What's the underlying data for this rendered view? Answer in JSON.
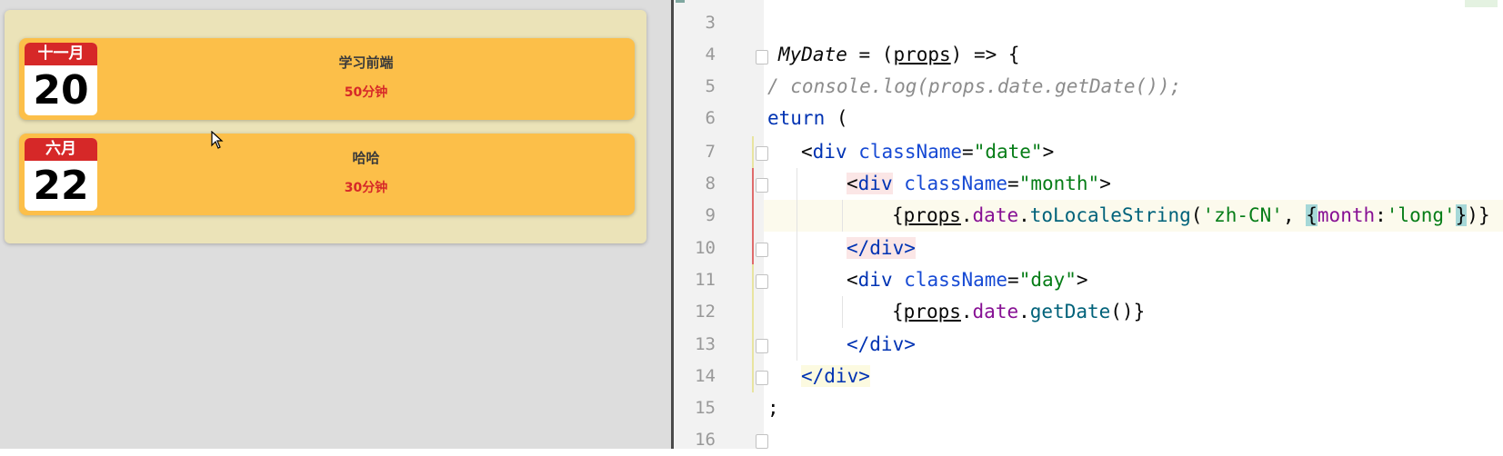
{
  "preview": {
    "items": [
      {
        "month": "十一月",
        "day": "20",
        "desc": "学习前端",
        "time": "50分钟"
      },
      {
        "month": "六月",
        "day": "22",
        "desc": "哈哈",
        "time": "30分钟"
      }
    ]
  },
  "editor": {
    "line_numbers": [
      "3",
      "4",
      "5",
      "6",
      "7",
      "8",
      "9",
      "10",
      "11",
      "12",
      "13",
      "14",
      "15",
      "16"
    ],
    "code": {
      "l4_name": "MyDate",
      "l4_eq": " = (",
      "l4_param": "props",
      "l4_arrow": ") => {",
      "l5_comment": "/ console.log(props.date.getDate());",
      "l6_kw": "eturn",
      "l6_paren": " (",
      "l7_open": "<",
      "l7_tag": "div",
      "l7_attr": "className",
      "l7_eq": "=",
      "l7_val": "\"date\"",
      "l7_close": ">",
      "l8_open": "<",
      "l8_tag": "div",
      "l8_attr": "className",
      "l8_eq": "=",
      "l8_val": "\"month\"",
      "l8_close": ">",
      "l9_lb": "{",
      "l9_props": "props",
      "l9_dot1": ".",
      "l9_date": "date",
      "l9_dot2": ".",
      "l9_fn": "toLocaleString",
      "l9_p1": "(",
      "l9_s1": "'zh-CN'",
      "l9_comma": ", ",
      "l9_ob": "{",
      "l9_key": "month",
      "l9_colon": ":",
      "l9_s2": "'long'",
      "l9_cb": "}",
      "l9_end": ")}",
      "l10_tag": "</div>",
      "l11_open": "<",
      "l11_tag": "div",
      "l11_attr": "className",
      "l11_eq": "=",
      "l11_val": "\"day\"",
      "l11_close": ">",
      "l12_lb": "{",
      "l12_props": "props",
      "l12_dot1": ".",
      "l12_date": "date",
      "l12_dot2": ".",
      "l12_fn": "getDate",
      "l12_end": "()}",
      "l13_tag": "</div>",
      "l14_tag": "</div>",
      "l15_semi": ";"
    }
  }
}
